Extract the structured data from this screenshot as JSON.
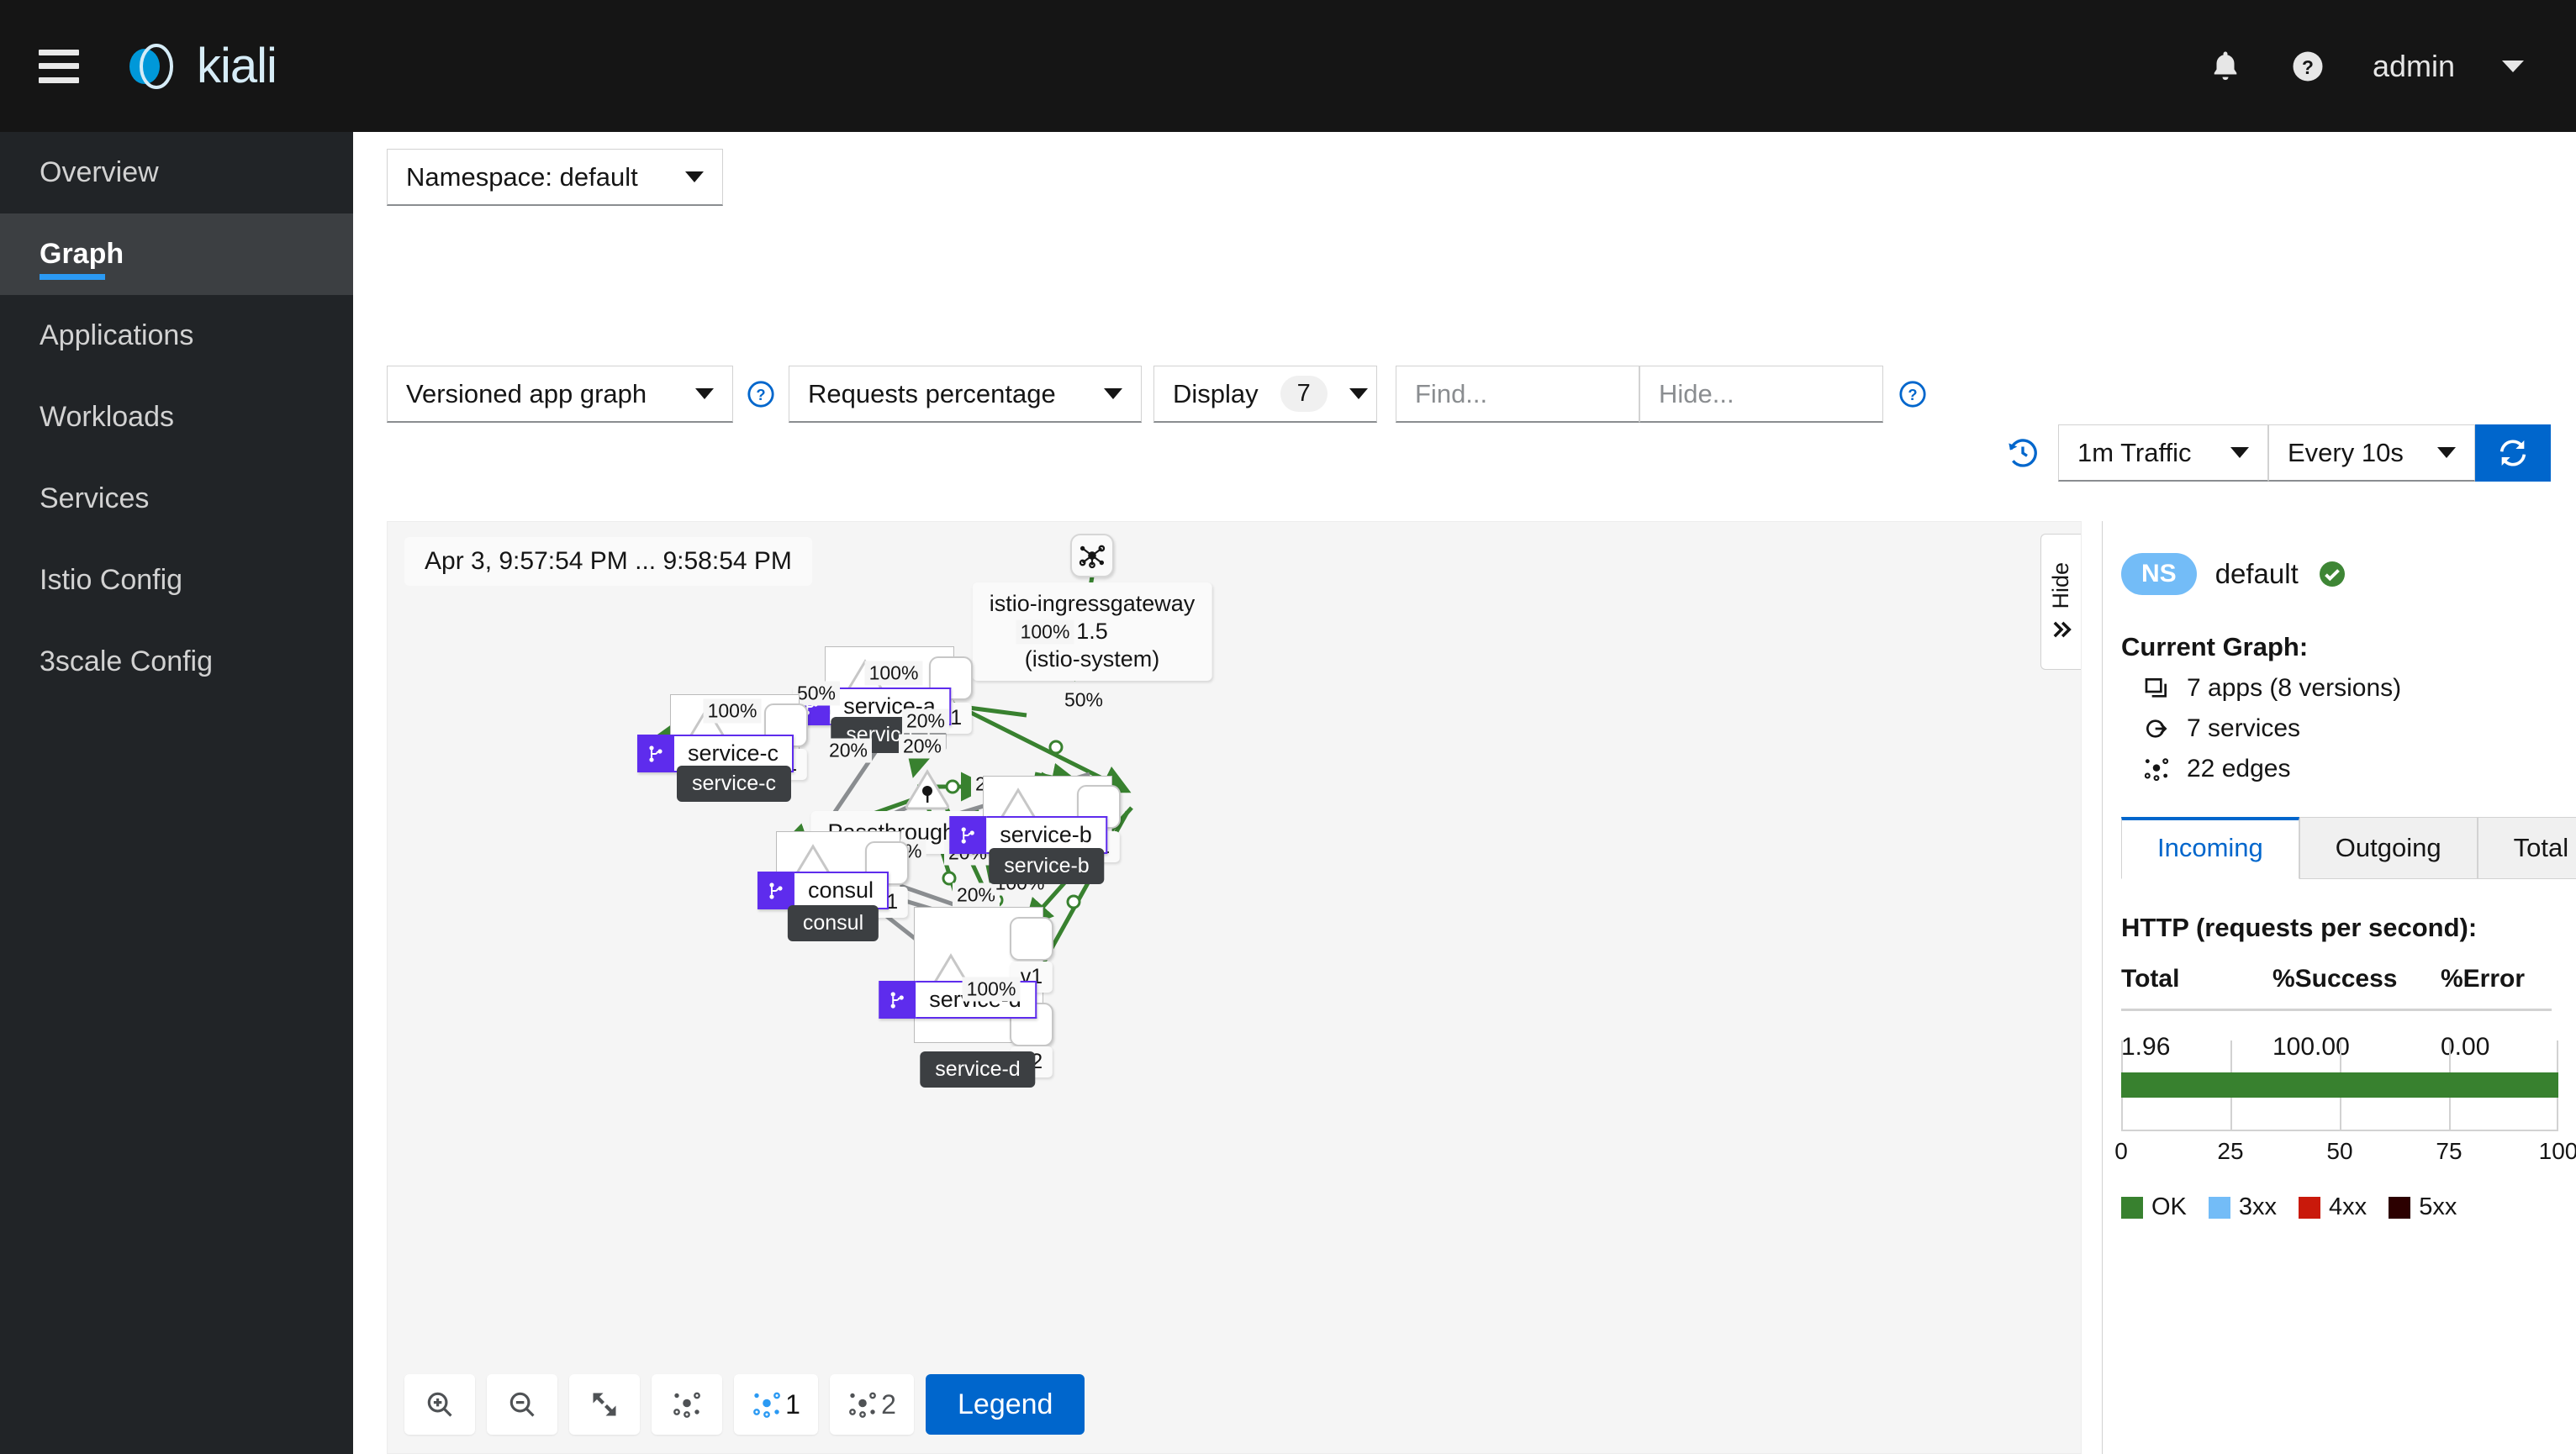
{
  "masthead": {
    "brand_name": "kiali",
    "menu_icon": "hamburger-icon",
    "bell_icon": "bell-icon",
    "help_icon": "help-circle-icon",
    "username": "admin"
  },
  "sidebar": {
    "items": [
      {
        "label": "Overview",
        "active": false
      },
      {
        "label": "Graph",
        "active": true
      },
      {
        "label": "Applications",
        "active": false
      },
      {
        "label": "Workloads",
        "active": false
      },
      {
        "label": "Services",
        "active": false
      },
      {
        "label": "Istio Config",
        "active": false
      },
      {
        "label": "3scale Config",
        "active": false
      }
    ]
  },
  "toolbar": {
    "namespace_selector": "Namespace: default",
    "graph_type": "Versioned app graph",
    "edge_labels": "Requests percentage",
    "display_label": "Display",
    "display_count": "7",
    "find_placeholder": "Find...",
    "hide_placeholder": "Hide...",
    "duration": "1m Traffic",
    "refresh_interval": "Every 10s",
    "refresh_button": "refresh-icon",
    "history_icon": "history-icon",
    "help_icon": "help-circle-icon"
  },
  "graph": {
    "time_range": "Apr 3, 9:57:54 PM ... 9:58:54 PM",
    "hide_panel_label": "Hide",
    "groups": [
      {
        "label": "service-a"
      },
      {
        "label": "service-c"
      },
      {
        "label": "service-b"
      },
      {
        "label": "consul"
      },
      {
        "label": "service-d"
      }
    ],
    "nodes": [
      {
        "name": "istio-ingressgateway",
        "version": "1.5",
        "namespace": "(istio-system)"
      },
      {
        "name": "PassthroughCluster"
      },
      {
        "name": "service-a",
        "versions": [
          "v1"
        ]
      },
      {
        "name": "service-b",
        "versions": [
          "v1"
        ]
      },
      {
        "name": "service-c",
        "versions": [
          "v1"
        ]
      },
      {
        "name": "service-d",
        "versions": [
          "v1",
          "v2"
        ]
      },
      {
        "name": "consul",
        "versions": [
          "v1"
        ]
      }
    ],
    "edge_labels": [
      "100%",
      "100%",
      "50%",
      "100%",
      "20%",
      "50%",
      "20%",
      "20%",
      "20%",
      "100%",
      "20%",
      "20%",
      "100%",
      "100%"
    ],
    "tools": {
      "zoom_in": "zoom-in-icon",
      "zoom_out": "zoom-out-icon",
      "fit_screen": "fit-to-screen-icon",
      "layout_default": "graph-layout-icon",
      "layout_1": "1",
      "layout_2": "2",
      "legend_button": "Legend"
    }
  },
  "side_panel": {
    "ns_badge": "NS",
    "ns_name": "default",
    "health_icon": "check-circle-icon",
    "current_graph_title": "Current Graph:",
    "stats": [
      {
        "icon": "apps-icon",
        "text": "7 apps (8 versions)"
      },
      {
        "icon": "services-icon",
        "text": "7 services"
      },
      {
        "icon": "edges-icon",
        "text": "22 edges"
      }
    ],
    "tabs": [
      {
        "label": "Incoming",
        "active": true
      },
      {
        "label": "Outgoing",
        "active": false
      },
      {
        "label": "Total",
        "active": false
      }
    ],
    "http_title": "HTTP (requests per second):",
    "table": {
      "headers": [
        "Total",
        "%Success",
        "%Error"
      ],
      "rows": [
        [
          "1.96",
          "100.00",
          "0.00"
        ]
      ]
    }
  },
  "chart_data": {
    "type": "bar",
    "orientation": "horizontal",
    "stacked": true,
    "title": "",
    "categories": [
      "HTTP"
    ],
    "series": [
      {
        "name": "OK",
        "values": [
          100
        ],
        "color": "#38812f"
      },
      {
        "name": "3xx",
        "values": [
          0
        ],
        "color": "#73bcf7"
      },
      {
        "name": "4xx",
        "values": [
          0
        ],
        "color": "#c9190b"
      },
      {
        "name": "5xx",
        "values": [
          0
        ],
        "color": "#2c0000"
      }
    ],
    "xlabel": "",
    "ylabel": "",
    "xlim": [
      0,
      100
    ],
    "xticks": [
      0,
      25,
      50,
      75,
      100
    ],
    "tick_labels": [
      "0",
      "25",
      "50",
      "75",
      "100"
    ],
    "legend": [
      "OK",
      "3xx",
      "4xx",
      "5xx"
    ],
    "legend_position": "bottom",
    "grid": true
  }
}
